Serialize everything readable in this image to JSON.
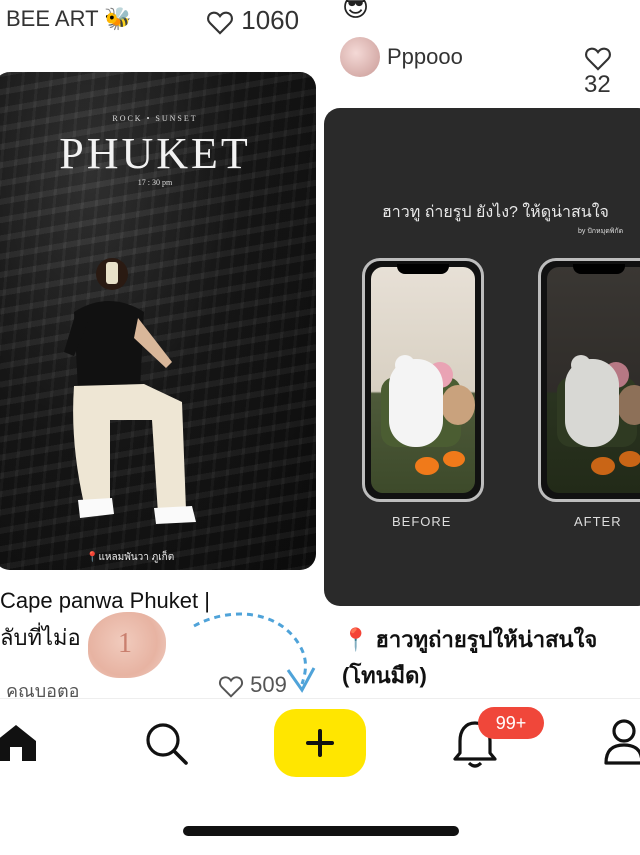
{
  "left_column": {
    "author": "BEE ART",
    "author_emoji": "🐝",
    "likes": "1060",
    "card": {
      "overlay_top": "ROCK • SUNSET",
      "overlay_title": "PHUKET",
      "overlay_time": "17 : 30 pm",
      "overlay_location": "📍แหลมพันวา ภูเก็ต"
    },
    "post_title_line1": "Cape panwa Phuket |",
    "post_title_line2": "ลับที่ไม่อ",
    "author2": "คุณบอตอ",
    "likes2": "509"
  },
  "right_column": {
    "top_emoji": "😎",
    "author": "Pppooo",
    "likes": "32",
    "card": {
      "headline": "ฮาวทู ถ่ายรูป ยังไง? ให้ดูน่าสนใจ",
      "byline": "by ปักหมุดพิกัด",
      "before_label": "BEFORE",
      "after_label": "AFTER"
    },
    "post_title_line1": "📍 ฮาวทูถ่ายรูปให้น่าสนใจ",
    "post_title_line2": "(โทนมืด)"
  },
  "overlay": {
    "step_number": "1"
  },
  "nav": {
    "badge_count": "99+"
  },
  "icons": [
    "heart-icon",
    "home-icon",
    "search-icon",
    "plus-icon",
    "bell-icon",
    "profile-icon",
    "arrow-icon"
  ],
  "colors": {
    "create_button": "#FFE600",
    "badge": "#F0473A"
  }
}
